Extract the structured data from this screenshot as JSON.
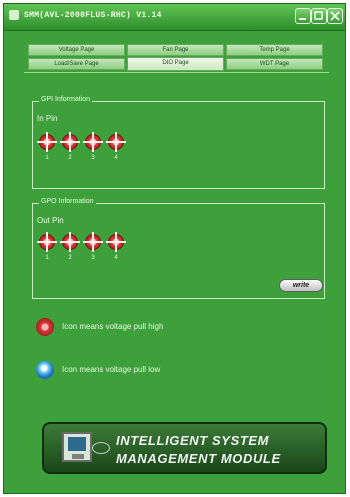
{
  "window": {
    "title": "SMM(AVL-2000FLUS-RHC) V1.14"
  },
  "tabs": {
    "row1": [
      "Voltage Page",
      "Fan Page",
      "Temp Page"
    ],
    "row2": [
      "Load/Save Page",
      "DIO Page",
      "WDT Page"
    ],
    "active": "DIO Page"
  },
  "gpi": {
    "group_title": "GPI Information",
    "label": "In Pin",
    "pins": [
      "1",
      "2",
      "3",
      "4"
    ]
  },
  "gpo": {
    "group_title": "GPO Information",
    "label": "Out Pin",
    "pins": [
      "1",
      "2",
      "3",
      "4"
    ],
    "write_label": "write"
  },
  "legend": {
    "high_text": "Icon means voltage pull high",
    "low_text": "Icon means voltage pull low"
  },
  "banner": {
    "line1": "INTELLIGENT  SYSTEM",
    "line2": "MANAGEMENT  MODULE"
  },
  "colors": {
    "background": "#3ea03a",
    "pin_high": "#d83a3a",
    "pin_low": "#1b6fb8"
  }
}
